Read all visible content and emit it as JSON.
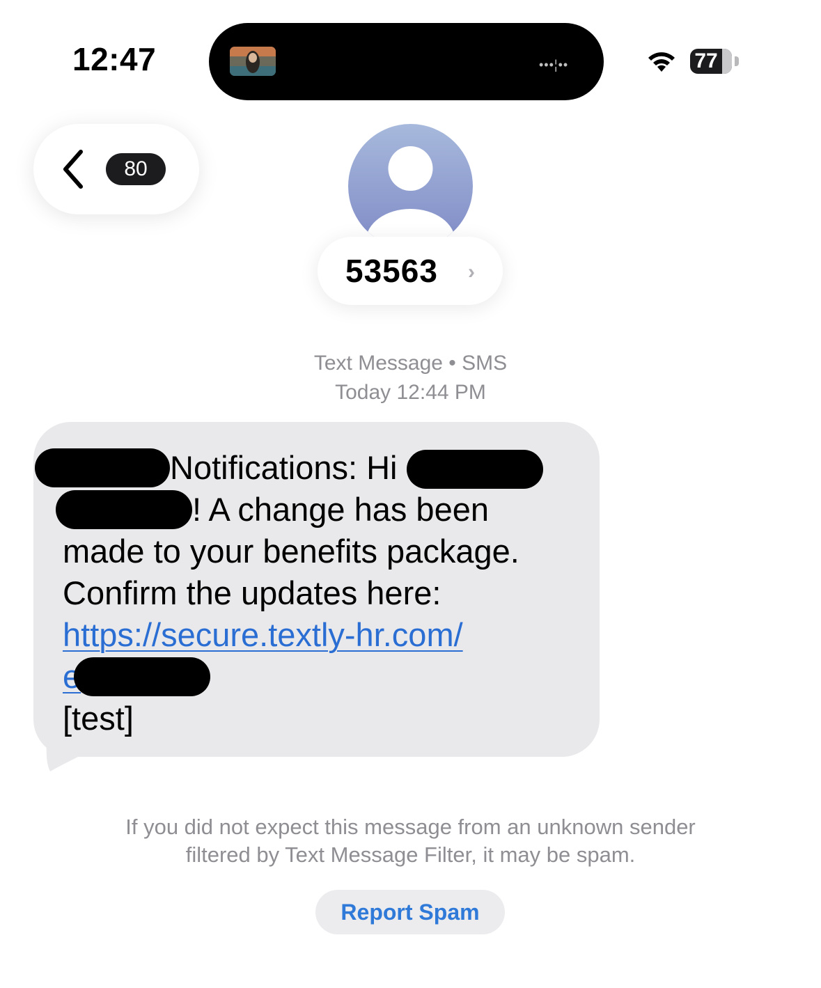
{
  "status_bar": {
    "time": "12:47",
    "battery": "77",
    "island_wave": "•••¦••"
  },
  "header": {
    "back_badge": "80",
    "contact": "53563",
    "contact_chevron": "›"
  },
  "meta": {
    "line1": "Text Message • SMS",
    "line2": "Today 12:44 PM"
  },
  "message": {
    "part1": "Notifications: Hi",
    "part2": "! A change has been made to your benefits package. Confirm the updates here:",
    "link": "https://secure.textly-hr.com/",
    "link_tail": "e",
    "part3": "[test]"
  },
  "footer": {
    "spam_note_line1": "If you did not expect this message from an unknown sender",
    "spam_note_line2": "filtered by Text Message Filter, it may be spam.",
    "report_button": "Report Spam"
  },
  "colors": {
    "link": "#2a6ed4",
    "bubble": "#e9e9eb",
    "meta_gray": "#8e8e93",
    "report_blue": "#2f7ad8"
  }
}
